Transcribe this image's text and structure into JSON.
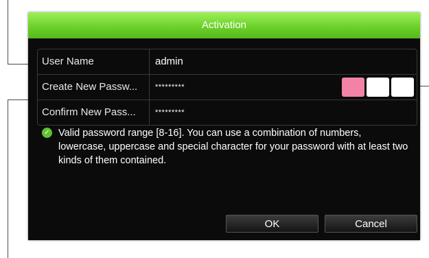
{
  "dialog": {
    "title": "Activation",
    "fields": {
      "username": {
        "label": "User Name",
        "value": "admin"
      },
      "create_password": {
        "label": "Create New Passw...",
        "value": "*********"
      },
      "confirm_password": {
        "label": "Confirm New Pass...",
        "value": "*********"
      }
    },
    "strength_colors": [
      "#f283a6",
      "#ffffff",
      "#ffffff"
    ],
    "note": "Valid password range [8-16]. You can use a combination of numbers, lowercase, uppercase and special character for your password with at least two kinds of them contained.",
    "ok_label": "OK",
    "cancel_label": "Cancel"
  },
  "colors": {
    "title_bar": "#6cd12a",
    "background": "#0b0b0b",
    "check": "#5fc233"
  }
}
